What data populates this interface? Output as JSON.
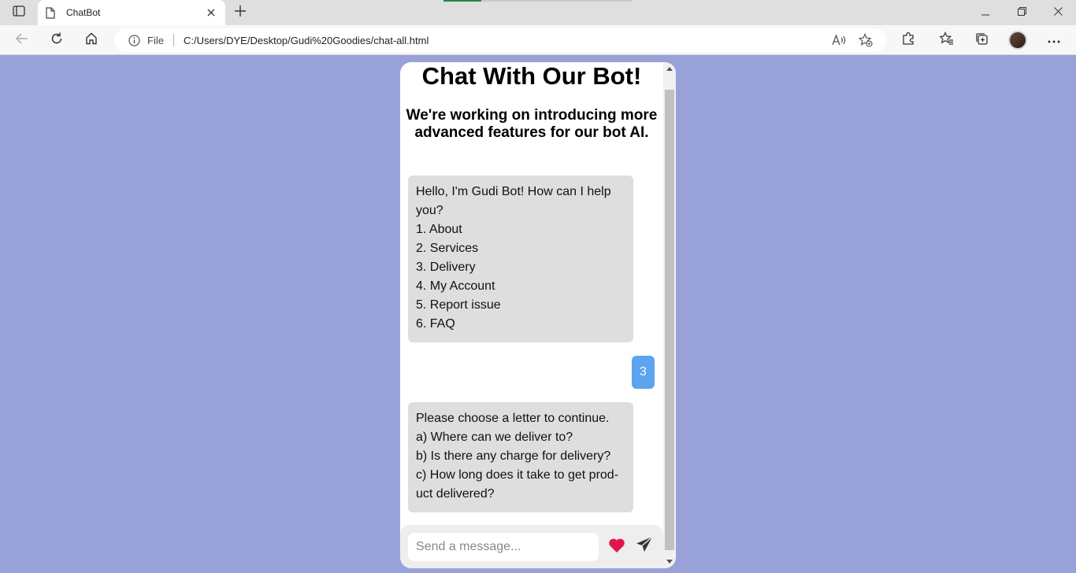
{
  "browser": {
    "tab_title": "ChatBot",
    "address_label": "File",
    "url": "C:/Users/DYE/Desktop/Gudi%20Goodies/chat-all.html"
  },
  "chat": {
    "title": "Chat With Our Bot!",
    "subtitle": "We're working on introducing more advanced features for our bot AI.",
    "messages": [
      {
        "from": "bot",
        "lines": [
          "Hello, I'm Gudi Bot! How can I help",
          "you?",
          "1. About",
          "2. Services",
          "3. Delivery",
          "4. My Account",
          "5. Report issue",
          "6. FAQ"
        ]
      },
      {
        "from": "user",
        "text": "3"
      },
      {
        "from": "bot",
        "lines": [
          "Please choose a letter to continue.",
          "a) Where can we deliver to?",
          "b) Is there any charge for delivery?",
          "c) How long does it take to get prod-",
          "uct delivered?"
        ]
      }
    ],
    "input_placeholder": "Send a message...",
    "input_value": ""
  },
  "colors": {
    "page_background": "#98a2d8",
    "bot_bubble": "#dedede",
    "user_bubble": "#5ca3f0",
    "heart": "#e0174a"
  },
  "icons": [
    "tab-actions-icon",
    "page-icon",
    "close-icon",
    "plus-icon",
    "minimize-icon",
    "restore-icon",
    "window-close-icon",
    "back-icon",
    "refresh-icon",
    "home-icon",
    "info-icon",
    "read-aloud-icon",
    "add-favorite-icon",
    "extensions-icon",
    "favorites-icon",
    "collections-icon",
    "more-icon",
    "heart-icon",
    "send-icon"
  ]
}
